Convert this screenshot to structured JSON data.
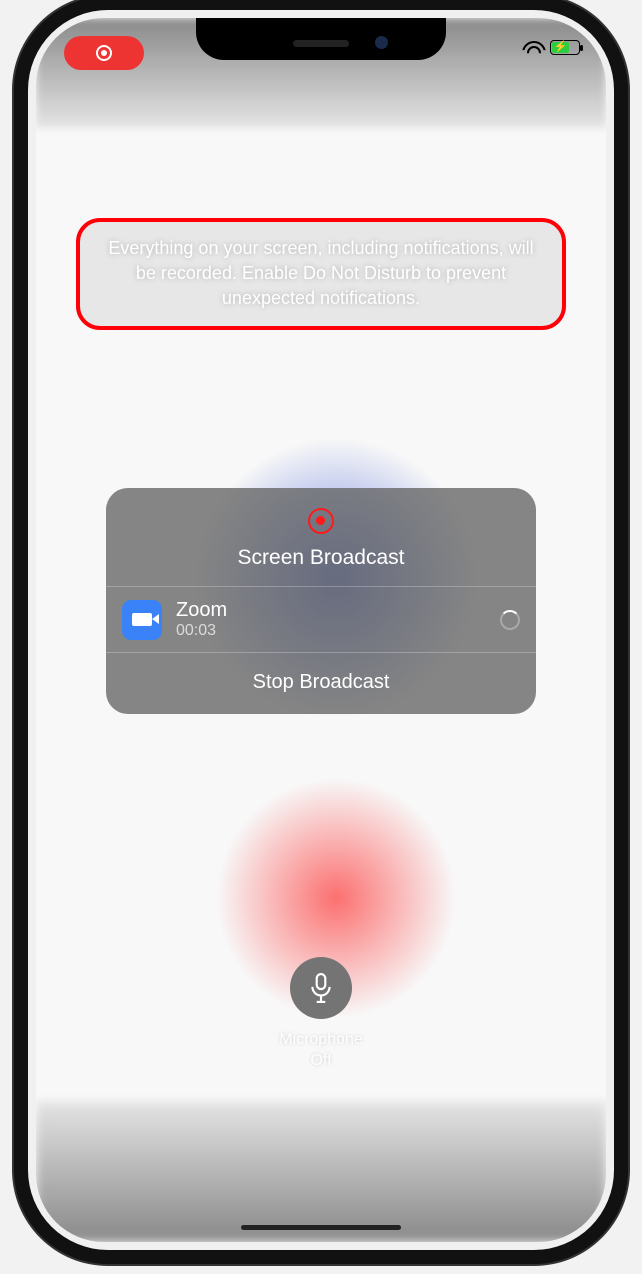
{
  "status": {
    "recording_indicator": true
  },
  "warning": {
    "text": "Everything on your screen, including notifications, will be recorded. Enable Do Not Disturb to prevent unexpected notifications."
  },
  "broadcast_panel": {
    "title": "Screen Broadcast",
    "app": {
      "name": "Zoom",
      "elapsed": "00:03",
      "icon": "video-camera-icon"
    },
    "stop_label": "Stop Broadcast"
  },
  "microphone": {
    "label_line1": "Microphone",
    "label_line2": "Off"
  }
}
